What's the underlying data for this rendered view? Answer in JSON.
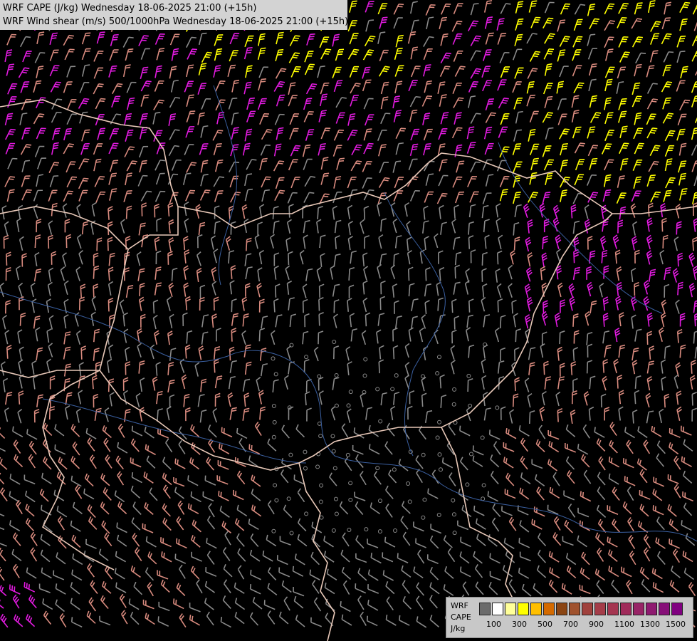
{
  "title": {
    "line1": "WRF CAPE (J/kg) Wednesday 18-06-2025 21:00 (+15h)",
    "line2": "WRF Wind shear (m/s) 500/1000hPa Wednesday 18-06-2025 21:00 (+15h)"
  },
  "legend": {
    "labels": [
      "WRF",
      "CAPE",
      "J/kg"
    ],
    "colors": [
      "#6b6b6b",
      "#ffffff",
      "#ffff99",
      "#ffff00",
      "#ffbf00",
      "#d46a00",
      "#8b4513",
      "#a0522d",
      "#a0413c",
      "#a43c48",
      "#a53550",
      "#a02a5a",
      "#982466",
      "#8f1a70",
      "#870f78",
      "#800080"
    ],
    "ticks": [
      "100",
      "300",
      "500",
      "700",
      "900",
      "1100",
      "1300",
      "1500"
    ]
  },
  "wind_colors": {
    "gray": "#8a8a8a",
    "salmon": "#d98b7f",
    "magenta": "#e21be0",
    "yellow": "#ffff00",
    "border": "#e8c8b8",
    "river": "#3a5fa0"
  }
}
